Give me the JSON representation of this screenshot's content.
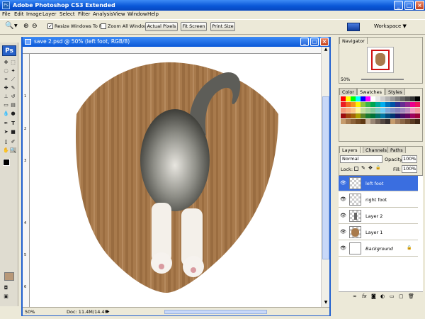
{
  "window": {
    "title": "Adobe Photoshop CS3 Extended",
    "min": "_",
    "max": "□",
    "close": "×"
  },
  "menu": [
    "File",
    "Edit",
    "Image",
    "Layer",
    "Select",
    "Filter",
    "Analysis",
    "View",
    "Window",
    "Help"
  ],
  "options": {
    "resize_windows": "Resize Windows To Fit",
    "zoom_all_windows": "Zoom All Windows",
    "actual_pixels": "Actual Pixels",
    "fit_screen": "Fit Screen",
    "print_size": "Print Size",
    "workspace": "Workspace ▼"
  },
  "document": {
    "title": "save 2.psd @ 50% (left foot, RGB/8)",
    "zoom": "50%",
    "doc_info": "Doc: 11.4M/14.4M",
    "ruler_left": [
      "1",
      "2",
      "3",
      "4",
      "5",
      "6"
    ]
  },
  "navigator": {
    "tab": "Navigator",
    "zoom": "50%"
  },
  "swatch_panel": {
    "tabs": [
      "Color",
      "Swatches",
      "Styles"
    ],
    "colors": [
      "#ff0000",
      "#ffff00",
      "#00ff00",
      "#00ffff",
      "#0000ff",
      "#ff00ff",
      "#ffffff",
      "#e6e6e6",
      "#cccccc",
      "#b3b3b3",
      "#999999",
      "#808080",
      "#666666",
      "#4d4d4d",
      "#333333",
      "#000000",
      "#ed1c24",
      "#f26522",
      "#f7941d",
      "#fff200",
      "#8dc63f",
      "#39b54a",
      "#00a651",
      "#00a99d",
      "#00aeef",
      "#0072bc",
      "#0054a6",
      "#2e3192",
      "#662d91",
      "#92278f",
      "#ec008c",
      "#ed145b",
      "#f69679",
      "#f9ad81",
      "#fdc689",
      "#fff799",
      "#c4df9b",
      "#a3d39c",
      "#82ca9c",
      "#7accc8",
      "#6dcff6",
      "#7da7d9",
      "#8393ca",
      "#8781bd",
      "#a186be",
      "#bd8cbf",
      "#f49ac1",
      "#f5989d",
      "#9e0b0f",
      "#a0410d",
      "#a36209",
      "#aba000",
      "#598527",
      "#1a7b30",
      "#007236",
      "#00746b",
      "#0076a3",
      "#004a80",
      "#003471",
      "#1b1464",
      "#440e62",
      "#630460",
      "#9e005d",
      "#9e0039",
      "#c69c6d",
      "#a67c52",
      "#8c6239",
      "#754c24",
      "#603913",
      "#c7b299",
      "#998675",
      "#736357",
      "#534741",
      "#362f2d",
      "#c69c6e",
      "#a37e5f",
      "#8b6746",
      "#725033",
      "#5a3a22",
      "#3f2514"
    ]
  },
  "layers_panel": {
    "tabs": [
      "Layers",
      "Channels",
      "Paths"
    ],
    "blend_mode": "Normal",
    "opacity_label": "Opacity:",
    "opacity_value": "100%",
    "lock_label": "Lock:",
    "fill_label": "Fill:",
    "fill_value": "100%",
    "layers": [
      {
        "name": "left foot",
        "selected": true
      },
      {
        "name": "right foot",
        "selected": false
      },
      {
        "name": "Layer 2",
        "selected": false
      },
      {
        "name": "Layer 1",
        "selected": false
      },
      {
        "name": "Background",
        "selected": false
      }
    ]
  },
  "icons": {
    "eye": "👁",
    "lock": "🔒"
  }
}
